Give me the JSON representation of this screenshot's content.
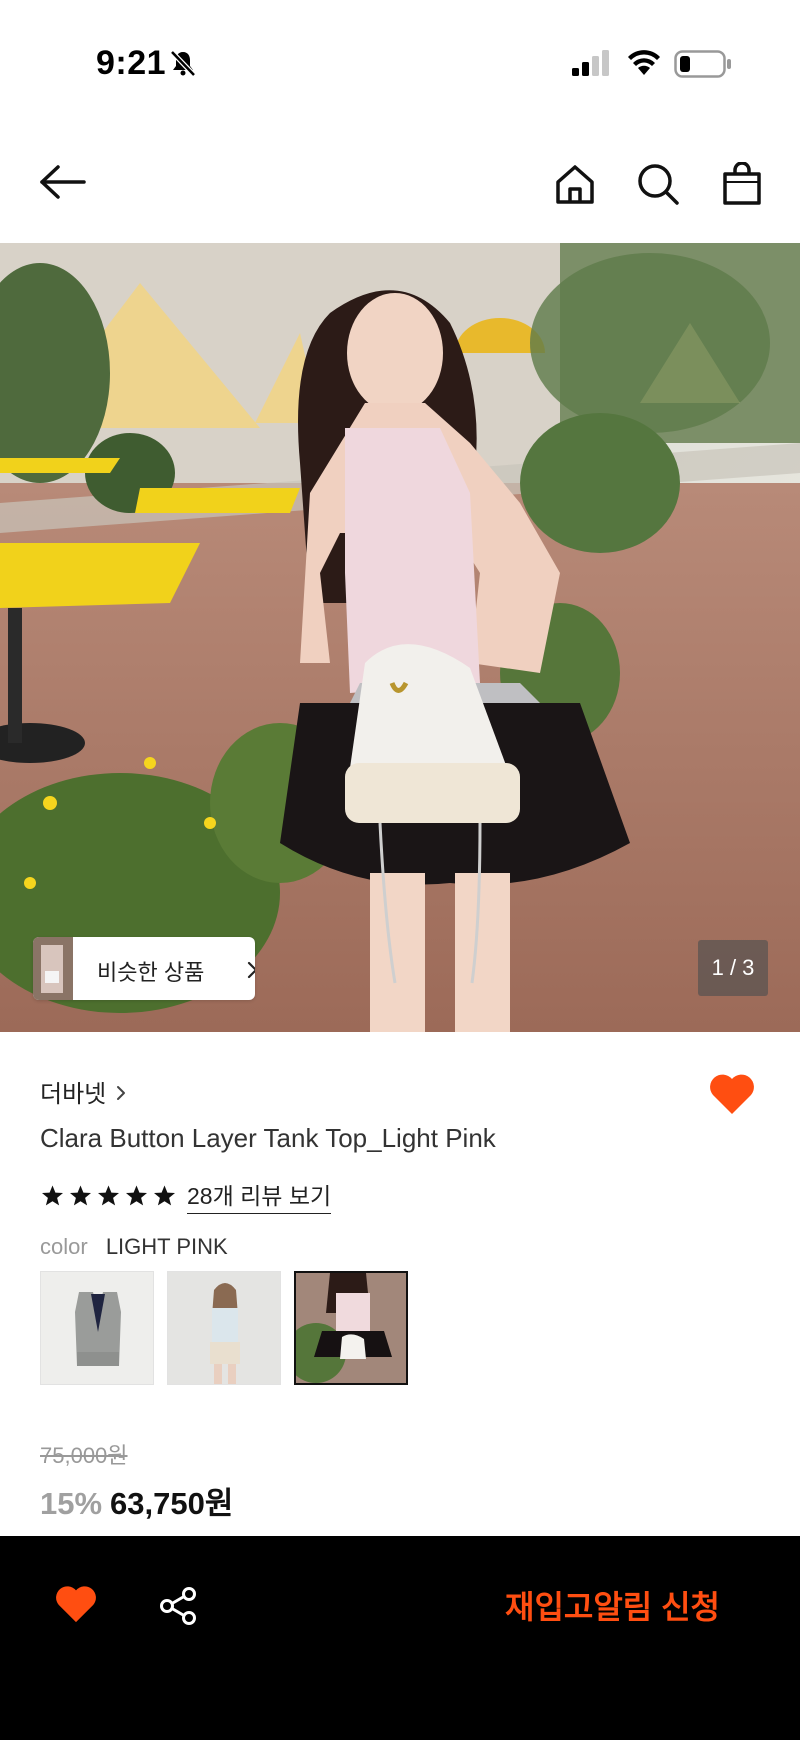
{
  "status_bar": {
    "time": "9:21"
  },
  "nav": {
    "icons": [
      "back-arrow-icon",
      "home-icon",
      "search-icon",
      "shopping-bag-icon"
    ]
  },
  "hero": {
    "similar_label": "비슷한 상품",
    "image_counter": "1 / 3"
  },
  "product": {
    "brand": "더바넷",
    "title": "Clara Button Layer Tank Top_Light Pink",
    "rating_stars": 5,
    "review_link": "28개 리뷰 보기",
    "color_label": "color",
    "color_value": "LIGHT PINK",
    "swatches": [
      "gray vest",
      "light blue top",
      "light pink tank top"
    ],
    "selected_swatch": 2,
    "wishlisted": true
  },
  "price": {
    "original": "75,000원",
    "discount": "15%",
    "final": "63,750원"
  },
  "bottom_bar": {
    "restock_label": "재입고알림 신청"
  },
  "colors": {
    "accent": "#ff4e11",
    "bottom_bar_bg": "#000000"
  }
}
